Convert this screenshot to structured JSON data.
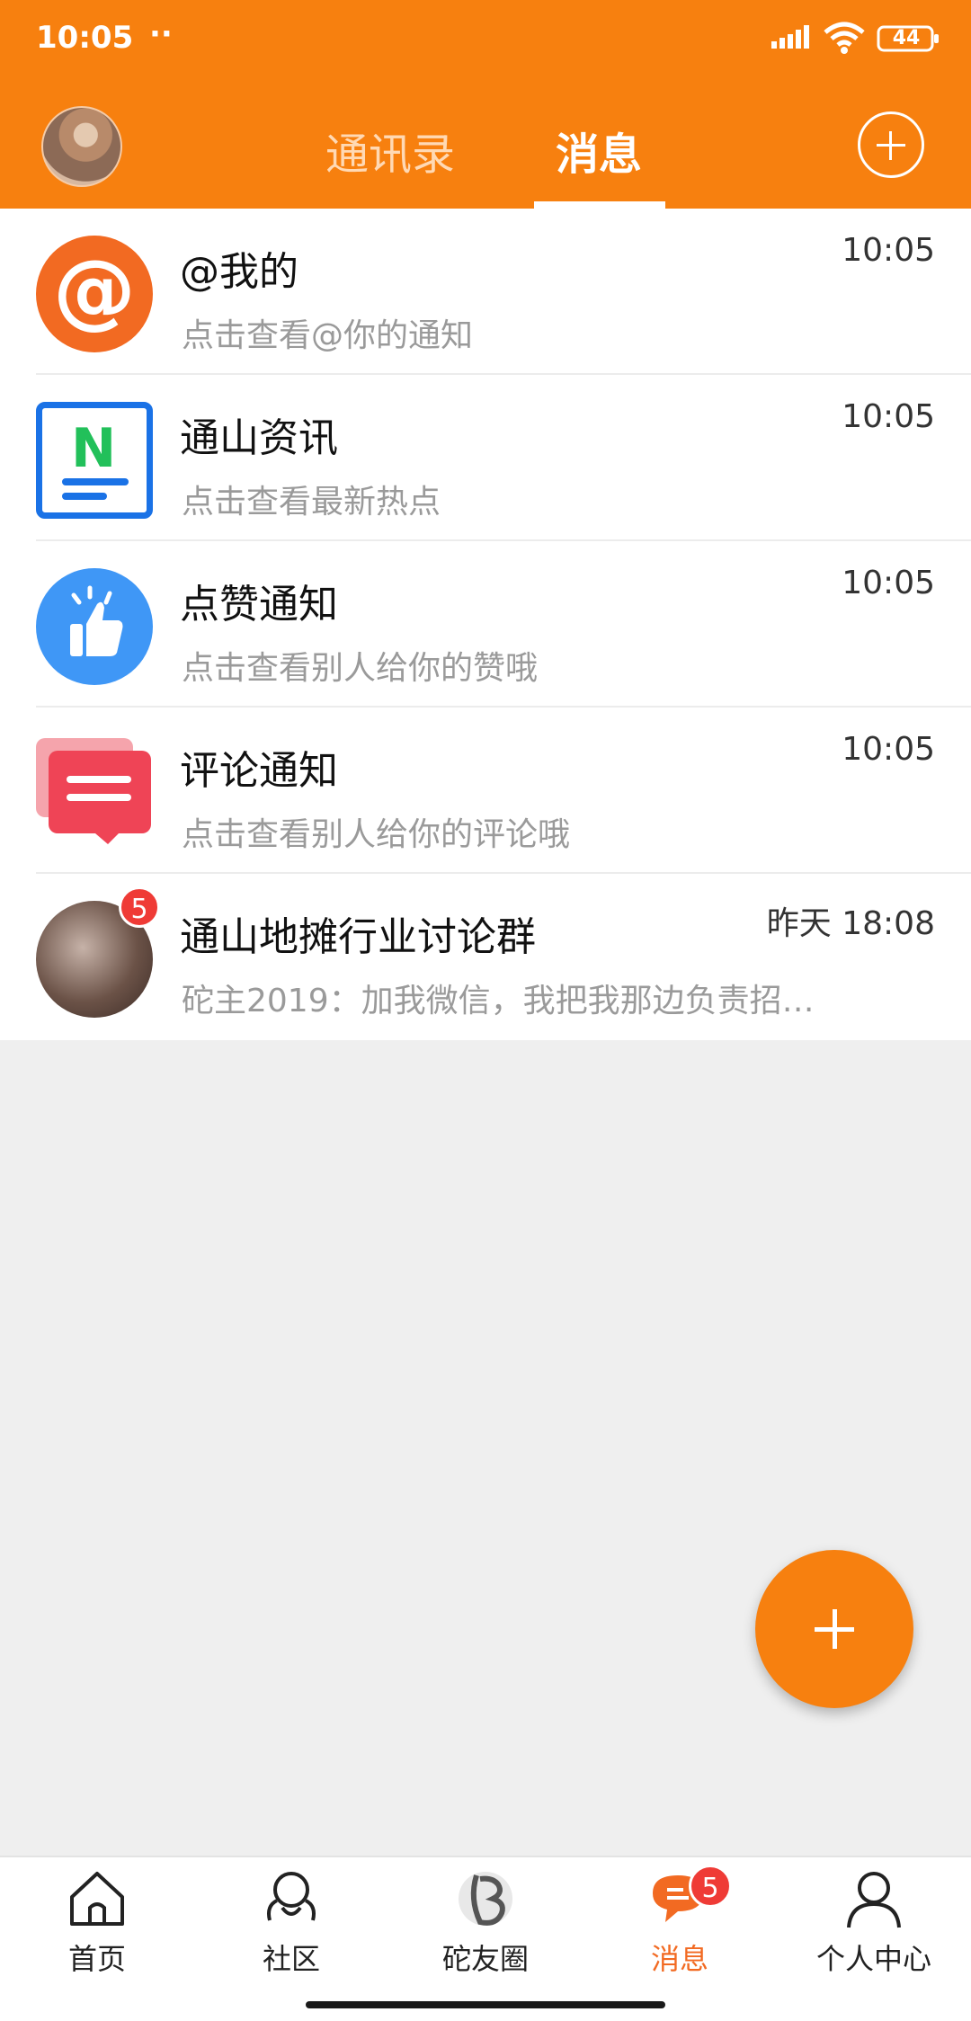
{
  "status_bar": {
    "time": "10:05",
    "dots": "··",
    "battery": "44"
  },
  "header": {
    "tabs": [
      {
        "label": "通讯录"
      },
      {
        "label": "消息"
      }
    ],
    "active_tab": "消息"
  },
  "messages": [
    {
      "title": "@我的",
      "subtitle": "点击查看@你的通知",
      "time": "10:05",
      "icon": "at-icon"
    },
    {
      "title": "通山资讯",
      "subtitle": "点击查看最新热点",
      "time": "10:05",
      "icon": "news-icon"
    },
    {
      "title": "点赞通知",
      "subtitle": "点击查看别人给你的赞哦",
      "time": "10:05",
      "icon": "thumbs-up-icon"
    },
    {
      "title": "评论通知",
      "subtitle": "点击查看别人给你的评论哦",
      "time": "10:05",
      "icon": "comment-icon"
    },
    {
      "title": "通山地摊行业讨论群",
      "subtitle": "砣主2019：加我微信，我把我那边负责招…",
      "time": "昨天 18:08",
      "icon": "group-avatar",
      "badge": "5"
    }
  ],
  "bottom_nav": {
    "items": [
      {
        "label": "首页",
        "icon": "home-icon"
      },
      {
        "label": "社区",
        "icon": "community-icon"
      },
      {
        "label": "砣友圈",
        "icon": "circle-logo-icon"
      },
      {
        "label": "消息",
        "icon": "message-icon",
        "badge": "5"
      },
      {
        "label": "个人中心",
        "icon": "person-icon"
      }
    ],
    "active": "消息"
  },
  "colors": {
    "brand": "#f7800f",
    "badge": "#ef3b36",
    "active_label": "#f26a22"
  }
}
